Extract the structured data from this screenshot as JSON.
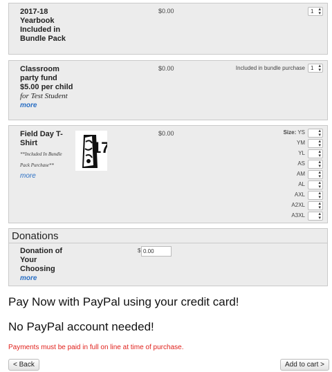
{
  "items": [
    {
      "name": "2017-18 Yearbook Included in Bundle Pack",
      "price": "$0.00",
      "qty": "1"
    },
    {
      "name": "Classroom party fund $5.00 per child",
      "name_suffix": "for Test Student",
      "more": "more",
      "price": "$0.00",
      "note": "Included in bundle purchase",
      "qty": "1"
    },
    {
      "name": "Field Day T-Shirt",
      "desc": "**Included In Bundle Pack Purchase**",
      "more": "more",
      "price": "$0.00",
      "image_text": "17",
      "size_label": "Size:",
      "sizes": [
        "YS",
        "YM",
        "YL",
        "AS",
        "AM",
        "AL",
        "AXL",
        "A2XL",
        "A3XL"
      ]
    }
  ],
  "donations": {
    "header": "Donations",
    "item_name": "Donation of Your Choosing",
    "more": "more",
    "currency": "$",
    "amount": "0.00"
  },
  "paypal": {
    "line1": "Pay Now with PayPal using your credit card!",
    "line2": "No PayPal account needed!",
    "notice": "Payments must be paid in full on line at time of purchase.",
    "notice_color": "#e0201b"
  },
  "nav": {
    "back_label": "< Back",
    "add_label": "Add to cart >"
  }
}
